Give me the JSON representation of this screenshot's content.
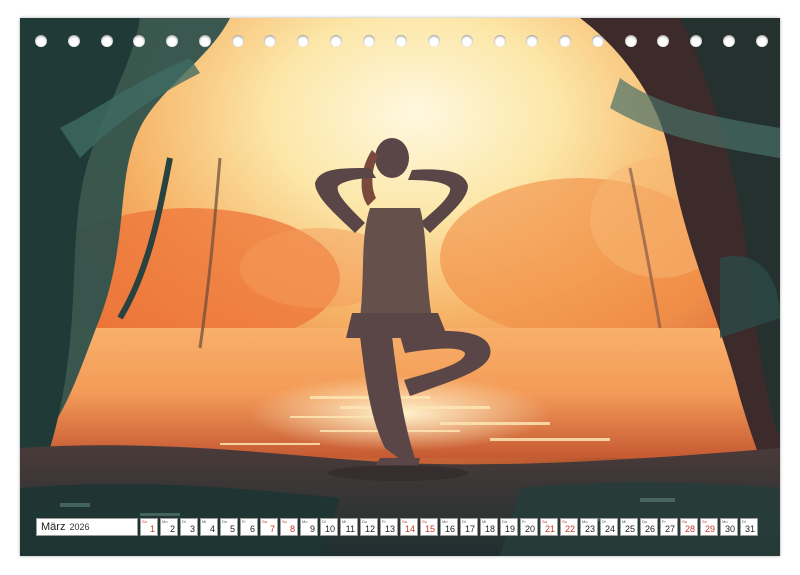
{
  "calendar": {
    "month": "März",
    "year": "2026",
    "days": [
      {
        "d": "1",
        "wd": "So",
        "weekend": true
      },
      {
        "d": "2",
        "wd": "Mo",
        "weekend": false
      },
      {
        "d": "3",
        "wd": "Di",
        "weekend": false
      },
      {
        "d": "4",
        "wd": "Mi",
        "weekend": false
      },
      {
        "d": "5",
        "wd": "Do",
        "weekend": false
      },
      {
        "d": "6",
        "wd": "Fr",
        "weekend": false
      },
      {
        "d": "7",
        "wd": "Sa",
        "weekend": true
      },
      {
        "d": "8",
        "wd": "So",
        "weekend": true
      },
      {
        "d": "9",
        "wd": "Mo",
        "weekend": false
      },
      {
        "d": "10",
        "wd": "Di",
        "weekend": false
      },
      {
        "d": "11",
        "wd": "Mi",
        "weekend": false
      },
      {
        "d": "12",
        "wd": "Do",
        "weekend": false
      },
      {
        "d": "13",
        "wd": "Fr",
        "weekend": false
      },
      {
        "d": "14",
        "wd": "Sa",
        "weekend": true
      },
      {
        "d": "15",
        "wd": "So",
        "weekend": true
      },
      {
        "d": "16",
        "wd": "Mo",
        "weekend": false
      },
      {
        "d": "17",
        "wd": "Di",
        "weekend": false
      },
      {
        "d": "18",
        "wd": "Mi",
        "weekend": false
      },
      {
        "d": "19",
        "wd": "Do",
        "weekend": false
      },
      {
        "d": "20",
        "wd": "Fr",
        "weekend": false
      },
      {
        "d": "21",
        "wd": "Sa",
        "weekend": true
      },
      {
        "d": "22",
        "wd": "So",
        "weekend": true
      },
      {
        "d": "23",
        "wd": "Mo",
        "weekend": false
      },
      {
        "d": "24",
        "wd": "Di",
        "weekend": false
      },
      {
        "d": "25",
        "wd": "Mi",
        "weekend": false
      },
      {
        "d": "26",
        "wd": "Do",
        "weekend": false
      },
      {
        "d": "27",
        "wd": "Fr",
        "weekend": false
      },
      {
        "d": "28",
        "wd": "Sa",
        "weekend": true
      },
      {
        "d": "29",
        "wd": "So",
        "weekend": true
      },
      {
        "d": "30",
        "wd": "Mo",
        "weekend": false
      },
      {
        "d": "31",
        "wd": "Di",
        "weekend": false
      }
    ]
  },
  "colors": {
    "sun_glow": "#fff6d8",
    "orange": "#f07a36",
    "deep_orange": "#c94a25",
    "teal_dark": "#274744",
    "silhouette": "#4a3a3a",
    "weekend_red": "#c0392b"
  },
  "binding_holes": 23
}
